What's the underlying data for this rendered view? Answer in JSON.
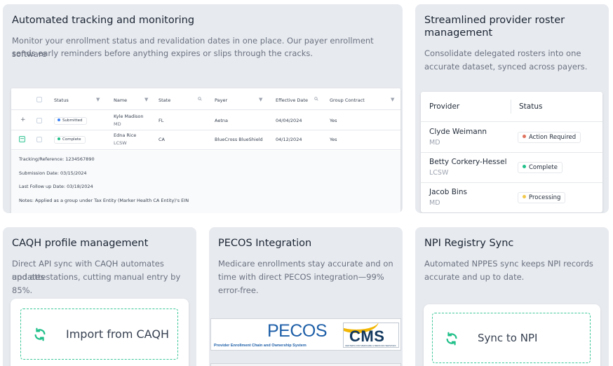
{
  "cards": {
    "tracking": {
      "title": "Automated tracking and monitoring",
      "desc_1": "Monitor your enrollment status and revalidation dates in one place. Our payer enrollment software",
      "desc_2": "sends early reminders before anything expires or slips through the cracks."
    },
    "roster": {
      "title_1": "Streamlined provider roster",
      "title_2": "management",
      "desc_1": "Consolidate delegated rosters into one",
      "desc_2": "accurate dataset, synced across payers."
    },
    "caqh": {
      "title": "CAQH profile management",
      "desc_1": "Direct API sync with CAQH automates updates",
      "desc_2": "and attestations, cutting manual entry by 85%.",
      "button_label": "Import from CAQH"
    },
    "pecos": {
      "title": "PECOS Integration",
      "desc_1": "Medicare enrollments stay accurate and on",
      "desc_2": "time with direct PECOS integration—99%",
      "desc_3": "error-free.",
      "logo_pecos": "PECOS",
      "logo_pecos_sub": "Provider Enrollment Chain and Ownership System",
      "logo_cms": "CMS",
      "logo_cms_sub": "CENTERS FOR MEDICARE & MEDICAID SERVICES"
    },
    "npi": {
      "title": "NPI Registry Sync",
      "desc_1": "Automated NPPES sync keeps NPI records",
      "desc_2": "accurate and up to date.",
      "button_label": "Sync to NPI"
    }
  },
  "enrollment_table": {
    "headers": [
      "Status",
      "Name",
      "State",
      "Payer",
      "Effective Date",
      "Group Contract"
    ],
    "rows": [
      {
        "expander": "+",
        "status": "Submitted",
        "name": "Kyle Madison",
        "credential": "MD",
        "state": "FL",
        "payer": "Aetna",
        "effective_date": "04/04/2024",
        "group_contract": "Yes"
      },
      {
        "expander": "−",
        "status": "Complete",
        "name": "Edna Rice",
        "credential": "LCSW",
        "state": "CA",
        "payer": "BlueCross BlueShield",
        "effective_date": "04/12/2024",
        "group_contract": "Yes"
      }
    ],
    "details": [
      "Tracking/Reference: 1234567890",
      "Submission Date: 03/15/2024",
      "Last Follow up Date: 03/18/2024",
      "Notes: Applied as a group under Tax Entity (Marker Health CA Entity)'s EIN"
    ]
  },
  "roster_table": {
    "headers": [
      "Provider",
      "Status"
    ],
    "rows": [
      {
        "name": "Clyde Weimann",
        "credential": "MD",
        "status": "Action Required",
        "status_color": "#e0735f"
      },
      {
        "name": "Betty Corkery-Hessel",
        "credential": "LCSW",
        "status": "Complete",
        "status_color": "#22c08a"
      },
      {
        "name": "Jacob Bins",
        "credential": "MD",
        "status": "Processing",
        "status_color": "#f2c94c"
      }
    ]
  },
  "colors": {
    "card_bg": "#e7eaef",
    "accent_green": "#3cc79a",
    "submitted_blue": "#3b82f6",
    "complete_green": "#22c08a"
  },
  "icons": {
    "sort": "funnel-icon",
    "search": "search-icon",
    "sync": "sync-arrows-icon"
  }
}
